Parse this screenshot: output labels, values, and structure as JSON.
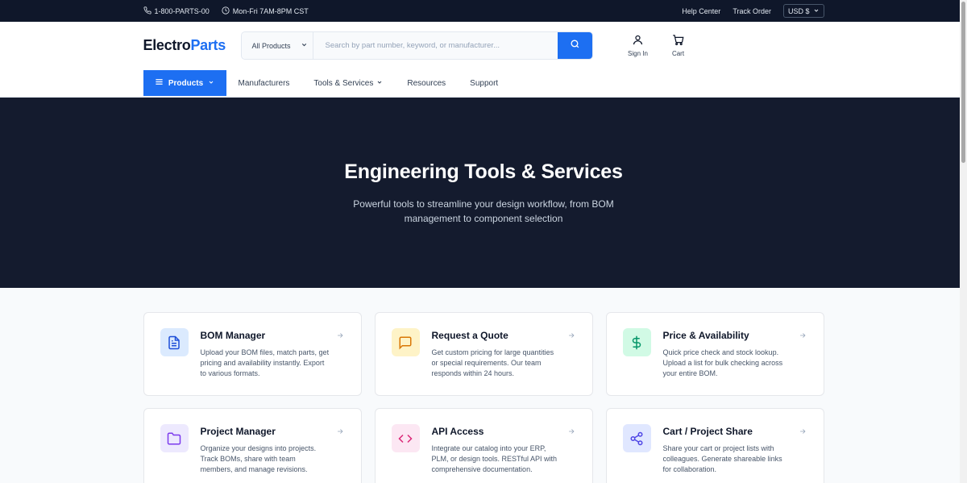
{
  "topbar": {
    "phone": "1-800-PARTS-00",
    "hours": "Mon-Fri 7AM-8PM CST",
    "links": [
      "Help Center",
      "Track Order"
    ],
    "currency": "USD $"
  },
  "header": {
    "logo_a": "Electro",
    "logo_b": "Parts",
    "search_category": "All Products",
    "search_placeholder": "Search by part number, keyword, or manufacturer...",
    "signin_label": "Sign In",
    "cart_label": "Cart"
  },
  "nav": {
    "products": "Products",
    "items": [
      "Manufacturers",
      "Tools & Services",
      "Resources",
      "Support"
    ]
  },
  "hero": {
    "title": "Engineering Tools & Services",
    "subtitle": "Powerful tools to streamline your design workflow, from BOM management to component selection"
  },
  "cards": [
    {
      "title": "BOM Manager",
      "desc": "Upload your BOM files, match parts, get pricing and availability instantly. Export to various formats.",
      "icon": "document-icon",
      "bg": "#dbeafe",
      "fg": "#1d4ed8"
    },
    {
      "title": "Request a Quote",
      "desc": "Get custom pricing for large quantities or special requirements. Our team responds within 24 hours.",
      "icon": "message-icon",
      "bg": "#fef3c7",
      "fg": "#d97706"
    },
    {
      "title": "Price & Availability",
      "desc": "Quick price check and stock lookup. Upload a list for bulk checking across your entire BOM.",
      "icon": "dollar-icon",
      "bg": "#d1fae5",
      "fg": "#059669"
    },
    {
      "title": "Project Manager",
      "desc": "Organize your designs into projects. Track BOMs, share with team members, and manage revisions.",
      "icon": "folder-icon",
      "bg": "#ede9fe",
      "fg": "#7c3aed"
    },
    {
      "title": "API Access",
      "desc": "Integrate our catalog into your ERP, PLM, or design tools. RESTful API with comprehensive documentation.",
      "icon": "code-icon",
      "bg": "#fce7f3",
      "fg": "#db2777"
    },
    {
      "title": "Cart / Project Share",
      "desc": "Share your cart or project lists with colleagues. Generate shareable links for collaboration.",
      "icon": "share-icon",
      "bg": "#e0e7ff",
      "fg": "#4f46e5"
    }
  ]
}
